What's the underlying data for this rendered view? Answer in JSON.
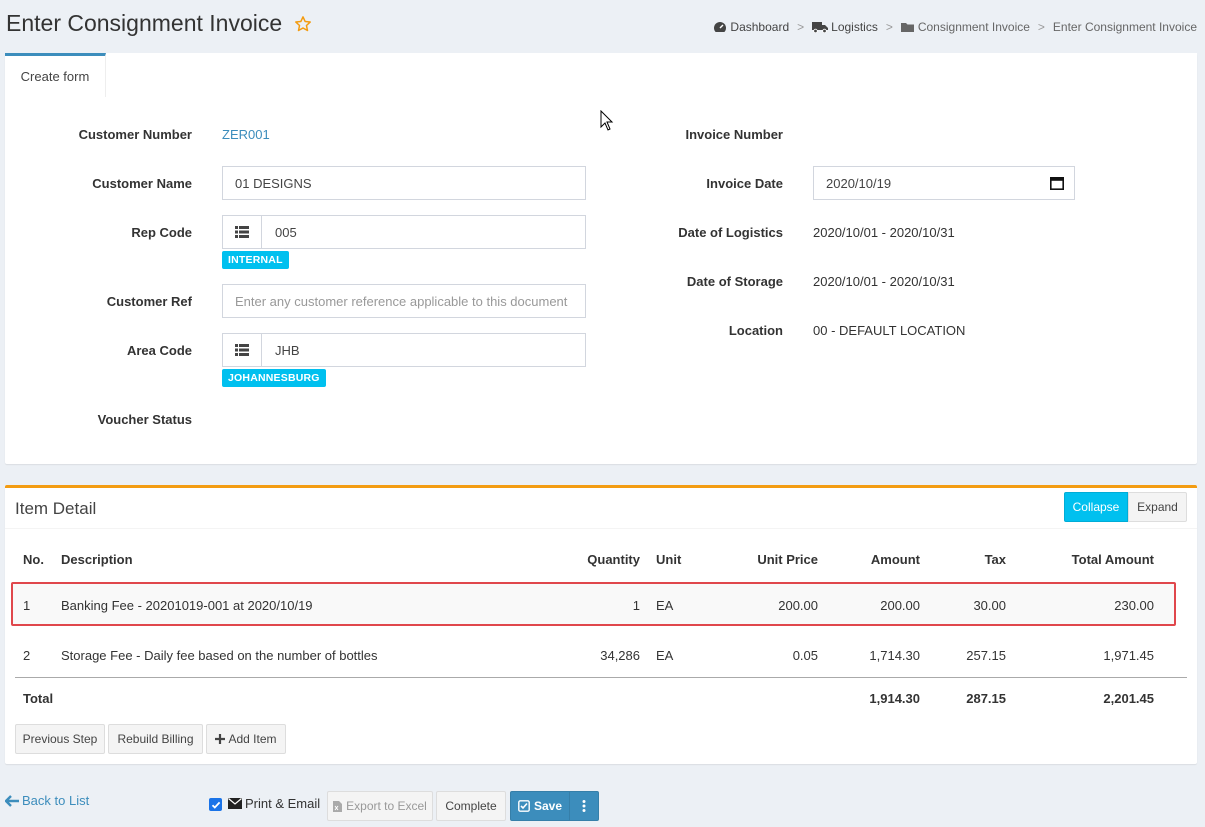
{
  "header": {
    "title": "Enter Consignment Invoice"
  },
  "breadcrumb": [
    {
      "label": "Dashboard",
      "icon": "dashboard-icon"
    },
    {
      "label": "Logistics",
      "icon": "truck-icon"
    },
    {
      "label": "Consignment Invoice",
      "icon": "folder-icon"
    },
    {
      "label": "Enter Consignment Invoice"
    }
  ],
  "tabs": [
    {
      "label": "Create form"
    }
  ],
  "form": {
    "customer_number": {
      "label": "Customer Number",
      "value": "ZER001"
    },
    "customer_name": {
      "label": "Customer Name",
      "value": "01 DESIGNS"
    },
    "rep_code": {
      "label": "Rep Code",
      "value": "005",
      "badge": "INTERNAL"
    },
    "customer_ref": {
      "label": "Customer Ref",
      "placeholder": "Enter any customer reference applicable to this document"
    },
    "area_code": {
      "label": "Area Code",
      "value": "JHB",
      "badge": "JOHANNESBURG"
    },
    "voucher_status": {
      "label": "Voucher Status"
    },
    "invoice_number": {
      "label": "Invoice Number"
    },
    "invoice_date": {
      "label": "Invoice Date",
      "value": "2020/10/19"
    },
    "date_of_logistics": {
      "label": "Date of Logistics",
      "value": "2020/10/01 - 2020/10/31"
    },
    "date_of_storage": {
      "label": "Date of Storage",
      "value": "2020/10/01 - 2020/10/31"
    },
    "location": {
      "label": "Location",
      "value": "00 - DEFAULT LOCATION"
    }
  },
  "items": {
    "title": "Item Detail",
    "collapse_label": "Collapse",
    "expand_label": "Expand",
    "columns": {
      "no": "No.",
      "description": "Description",
      "quantity": "Quantity",
      "unit": "Unit",
      "unit_price": "Unit Price",
      "amount": "Amount",
      "tax": "Tax",
      "total_amount": "Total Amount"
    },
    "rows": [
      {
        "no": "1",
        "description": "Banking Fee - 20201019-001 at 2020/10/19",
        "quantity": "1",
        "unit": "EA",
        "unit_price": "200.00",
        "amount": "200.00",
        "tax": "30.00",
        "total_amount": "230.00"
      },
      {
        "no": "2",
        "description": "Storage Fee - Daily fee based on the number of bottles",
        "quantity": "34,286",
        "unit": "EA",
        "unit_price": "0.05",
        "amount": "1,714.30",
        "tax": "257.15",
        "total_amount": "1,971.45"
      }
    ],
    "total": {
      "label": "Total",
      "amount": "1,914.30",
      "tax": "287.15",
      "total_amount": "2,201.45"
    },
    "buttons": {
      "previous_step": "Previous Step",
      "rebuild_billing": "Rebuild Billing",
      "add_item": "Add Item"
    }
  },
  "footer": {
    "back_to_list": "Back to List",
    "print_email": "Print & Email",
    "print_email_checked": true,
    "export_excel": "Export to Excel",
    "complete": "Complete",
    "save": "Save"
  },
  "colors": {
    "primary": "#3c8dbc",
    "info": "#00c0ef",
    "warning": "#f39c12",
    "highlight": "#e0474c"
  }
}
